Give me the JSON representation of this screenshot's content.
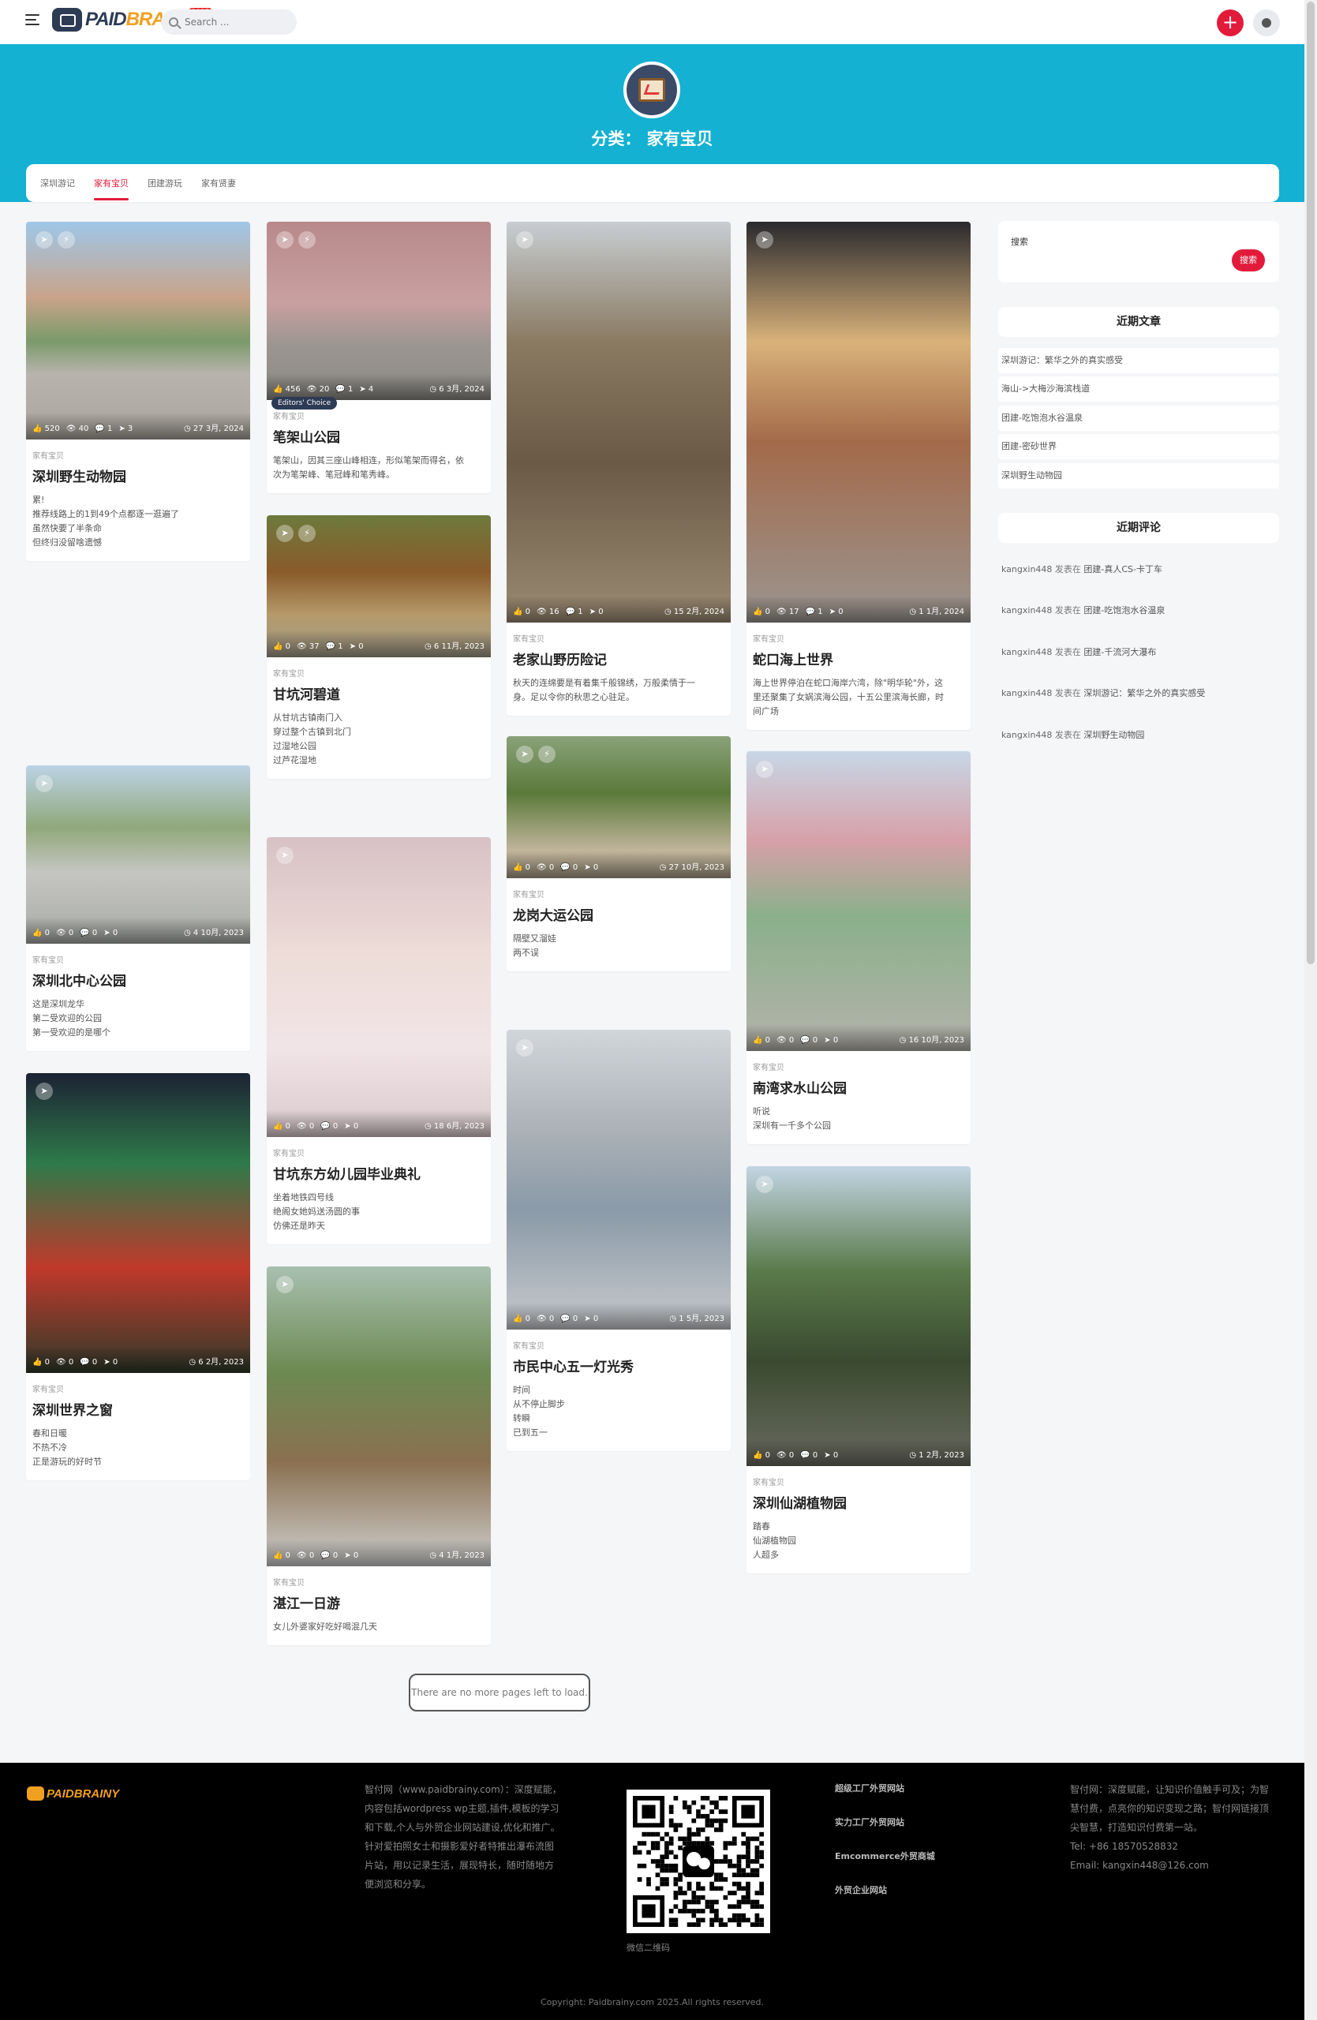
{
  "header": {
    "logo_paid": "PAID",
    "logo_brainy": "BRAINY",
    "logo_badge": "2025",
    "search_placeholder": "Search ..."
  },
  "hero": {
    "title": "分类：  家有宝贝"
  },
  "tabs": [
    "深圳游记",
    "家有宝贝",
    "团建游玩",
    "家有贤妻"
  ],
  "cards": [
    {
      "category": "家有宝贝",
      "title": "深圳野生动物园",
      "likes": "520",
      "views": "40",
      "comments": "1",
      "shares": "3",
      "date": "27 3月, 2024",
      "excerpt": [
        "累!",
        "推荐线路上的1到49个点都逐一逛遍了",
        "虽然快要了半条命",
        "但终归没留啥遗憾"
      ]
    },
    {
      "category": "家有宝贝",
      "title": "深圳北中心公园",
      "likes": "0",
      "views": "0",
      "comments": "0",
      "shares": "0",
      "date": "4 10月, 2023",
      "excerpt": [
        "这是深圳龙华",
        "第二受欢迎的公园",
        "第一受欢迎的是哪个"
      ]
    },
    {
      "category": "家有宝贝",
      "title": "深圳世界之窗",
      "likes": "0",
      "views": "0",
      "comments": "0",
      "shares": "0",
      "date": "6 2月, 2023",
      "excerpt": [
        "春和日暖",
        "不热不冷",
        "正是游玩的好时节"
      ]
    },
    {
      "category": "家有宝贝",
      "title": "笔架山公园",
      "likes": "456",
      "views": "20",
      "comments": "1",
      "shares": "4",
      "date": "6 3月, 2024",
      "badge": "Editors' Choice",
      "excerpt": [
        "笔架山，因其三座山峰相连，形似笔架而得名，依",
        "次为笔架峰、笔冠峰和笔秀峰。"
      ]
    },
    {
      "category": "家有宝贝",
      "title": "甘坑河碧道",
      "likes": "0",
      "views": "37",
      "comments": "1",
      "shares": "0",
      "date": "6 11月, 2023",
      "excerpt": [
        "从甘坑古镇南门入",
        "穿过整个古镇到北门",
        "过湿地公园",
        "过芦花湿地"
      ]
    },
    {
      "category": "家有宝贝",
      "title": "甘坑东方幼儿园毕业典礼",
      "likes": "0",
      "views": "0",
      "comments": "0",
      "shares": "0",
      "date": "18 6月, 2023",
      "excerpt": [
        "坐着地铁四号线",
        "绝阁女她妈送汤圆的事",
        "仿佛还是昨天"
      ]
    },
    {
      "category": "家有宝贝",
      "title": "湛江一日游",
      "likes": "0",
      "views": "0",
      "comments": "0",
      "shares": "0",
      "date": "4 1月, 2023",
      "excerpt": [
        "女儿外婆家好吃好喝混几天"
      ]
    },
    {
      "category": "家有宝贝",
      "title": "老家山野历险记",
      "likes": "0",
      "views": "16",
      "comments": "1",
      "shares": "0",
      "date": "15 2月, 2024",
      "excerpt": [
        "秋天的连绵要是有着集千般锦绣，万般柔情于一",
        "身。足以令你的秋思之心驻足。"
      ]
    },
    {
      "category": "家有宝贝",
      "title": "龙岗大运公园",
      "likes": "0",
      "views": "0",
      "comments": "0",
      "shares": "0",
      "date": "27 10月, 2023",
      "excerpt": [
        "隔壁又溜娃",
        "两不误"
      ]
    },
    {
      "category": "家有宝贝",
      "title": "市民中心五一灯光秀",
      "likes": "0",
      "views": "0",
      "comments": "0",
      "shares": "0",
      "date": "1 5月, 2023",
      "excerpt": [
        "时间",
        "从不停止脚步",
        "转瞬",
        "已到五一"
      ]
    },
    {
      "category": "家有宝贝",
      "title": "蛇口海上世界",
      "likes": "0",
      "views": "17",
      "comments": "1",
      "shares": "0",
      "date": "1 1月, 2024",
      "excerpt": [
        "海上世界停泊在蛇口海岸六湾，除\"明华轮\"外，这",
        "里还聚集了女娲滨海公园，十五公里滨海长廊，时",
        "间广场"
      ]
    },
    {
      "category": "家有宝贝",
      "title": "南湾求水山公园",
      "likes": "0",
      "views": "0",
      "comments": "0",
      "shares": "0",
      "date": "16 10月, 2023",
      "excerpt": [
        "听说",
        "深圳有一千多个公园"
      ]
    },
    {
      "category": "家有宝贝",
      "title": "深圳仙湖植物园",
      "likes": "0",
      "views": "0",
      "comments": "0",
      "shares": "0",
      "date": "1 2月, 2023",
      "excerpt": [
        "踏春",
        "仙湖植物园",
        "人超多"
      ]
    }
  ],
  "sidebar": {
    "search_label": "搜索",
    "search_button": "搜索",
    "recent_posts_title": "近期文章",
    "recent_posts": [
      "深圳游记：繁华之外的真实感受",
      "海山->大梅沙海滨栈道",
      "团建-吃饱泡水谷温泉",
      "团建-密砂世界",
      "深圳野生动物园"
    ],
    "recent_comments_title": "近期评论",
    "recent_comments": [
      {
        "user": "kangxin448",
        "verb": "发表在",
        "article": "团建-真人CS-卡丁车"
      },
      {
        "user": "kangxin448",
        "verb": "发表在",
        "article": "团建-吃饱泡水谷温泉"
      },
      {
        "user": "kangxin448",
        "verb": "发表在",
        "article": "团建-千流河大瀑布"
      },
      {
        "user": "kangxin448",
        "verb": "发表在",
        "article": "深圳游记：繁华之外的真实感受"
      },
      {
        "user": "kangxin448",
        "verb": "发表在",
        "article": "深圳野生动物园"
      }
    ]
  },
  "no_more": "There are no more pages left to load.",
  "footer": {
    "logo": "PAIDBRAINY",
    "about": "智付网（www.paidbrainy.com）：深度赋能，内容包括wordpress wp主题,插件,模板的学习和下载,个人与外贸企业网站建设,优化和推广。针对爱拍照女士和摄影爱好者特推出瀑布流图片站，用以记录生活，展现特长，随时随地方便浏览和分享。",
    "qr_caption": "微信二维码",
    "links": [
      "超级工厂外贸网站",
      "实力工厂外贸网站",
      "Emcommerce外贸商城",
      "外贸企业网站"
    ],
    "contact_text": "智付网：深度赋能，让知识价值触手可及；为智慧付费，点亮你的知识变现之路；智付网链接顶尖智慧，打造知识付费第一站。",
    "tel": "Tel:   +86 18570528832",
    "email": "Email:  kangxin448@126.com",
    "copyright": "Copyright: Paidbrainy.com 2025.All rights reserved."
  }
}
